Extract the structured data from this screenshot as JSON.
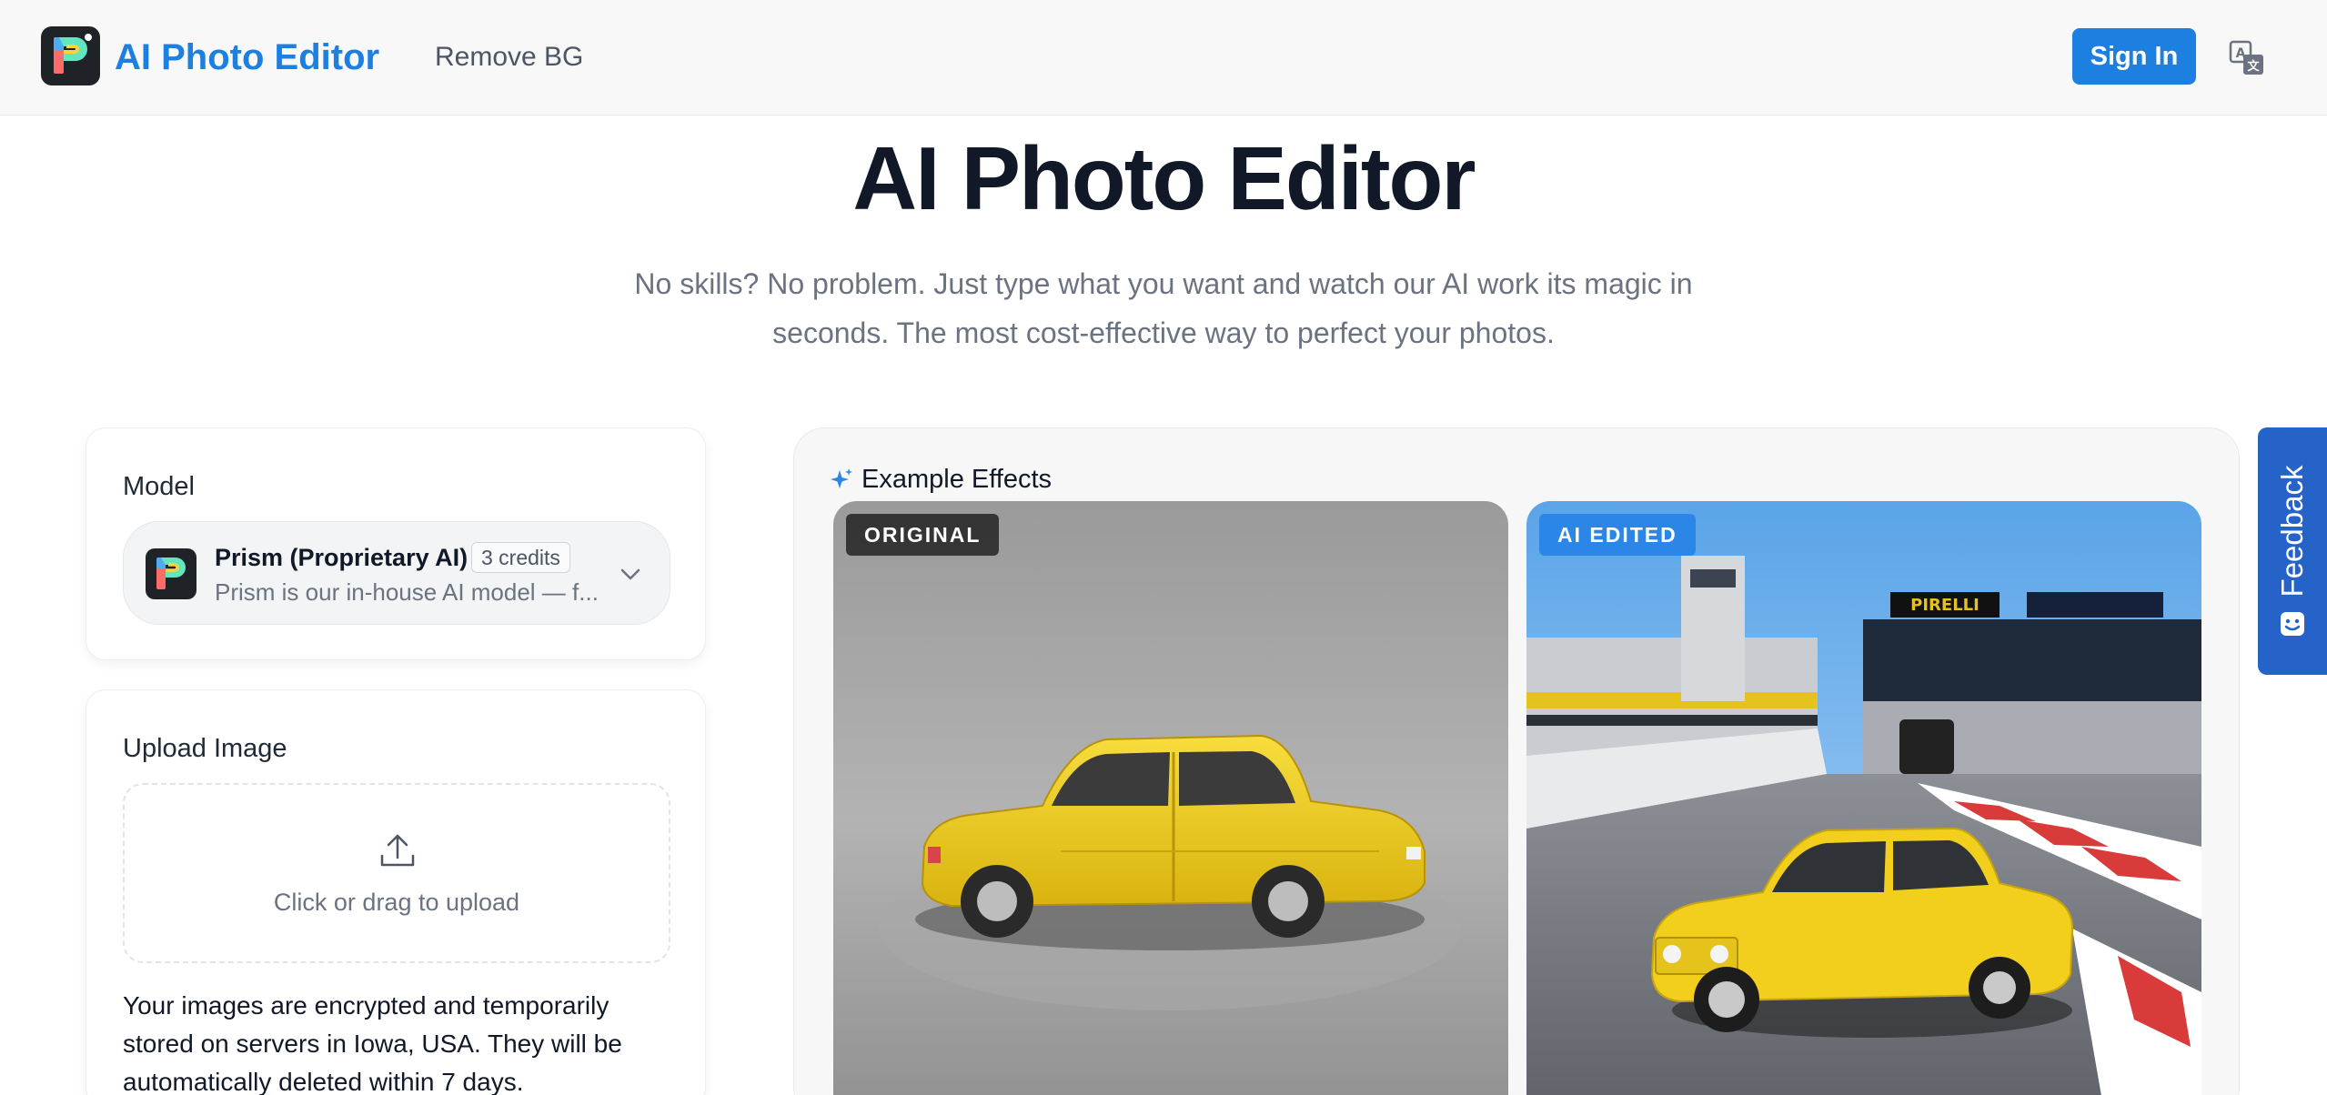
{
  "header": {
    "brand": "AI Photo Editor",
    "nav_remove_bg": "Remove BG",
    "sign_in": "Sign In",
    "translate_icon": "translate-icon"
  },
  "hero": {
    "title": "AI Photo Editor",
    "subtitle": "No skills? No problem. Just type what you want and watch our AI work its magic in seconds. The most cost-effective way to perfect your photos."
  },
  "model_card": {
    "title": "Model",
    "selected_name": "Prism (Proprietary AI)",
    "credits": "3 credits",
    "description": "Prism is our in-house AI model — f..."
  },
  "upload_card": {
    "title": "Upload Image",
    "dropzone_text": "Click or drag to upload",
    "privacy_note": "Your images are encrypted and temporarily stored on servers in Iowa, USA. They will be automatically deleted within 7 days."
  },
  "examples": {
    "title": "Example Effects",
    "original_tag": "ORIGINAL",
    "edited_tag": "AI EDITED"
  },
  "feedback": {
    "label": "Feedback"
  },
  "colors": {
    "accent": "#1d7fe0",
    "feedback": "#2563c9",
    "car_yellow": "#f2cf1d"
  }
}
